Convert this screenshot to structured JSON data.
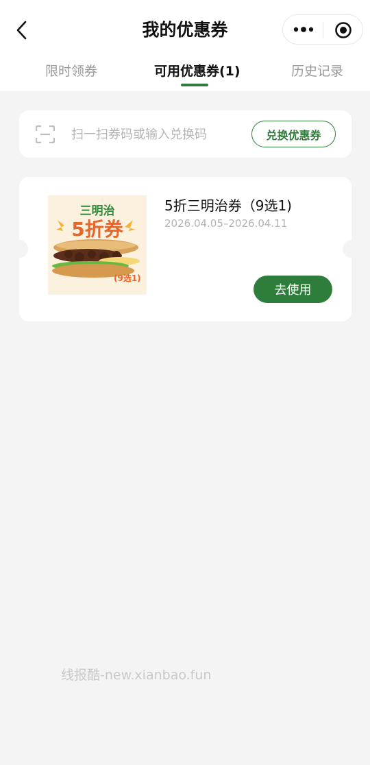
{
  "header": {
    "title": "我的优惠券",
    "back_icon": "chevron-left-icon",
    "more_icon": "more-dots-icon",
    "close_icon": "target-circle-icon"
  },
  "tabs": [
    {
      "label": "限时领券",
      "active": false
    },
    {
      "label": "可用优惠券(1)",
      "active": true
    },
    {
      "label": "历史记录",
      "active": false
    }
  ],
  "redeem": {
    "placeholder": "扫一扫券码或输入兑换码",
    "button_label": "兑换优惠券",
    "scan_icon": "scan-icon"
  },
  "coupons": [
    {
      "image_text_line1": "三明治",
      "image_text_line2": "5折券",
      "image_badge": "(9选1)",
      "title": "5折三明治券（9选1)",
      "validity": "2026.04.05–2026.04.11",
      "action_label": "去使用"
    }
  ],
  "watermark": "线报酷-new.xianbao.fun",
  "colors": {
    "accent": "#2f7d3a",
    "background": "#f4f4f4",
    "card": "#ffffff",
    "muted_text": "#b3b3b3",
    "thumb_orange": "#e8652a",
    "thumb_green": "#2e8b3a"
  }
}
